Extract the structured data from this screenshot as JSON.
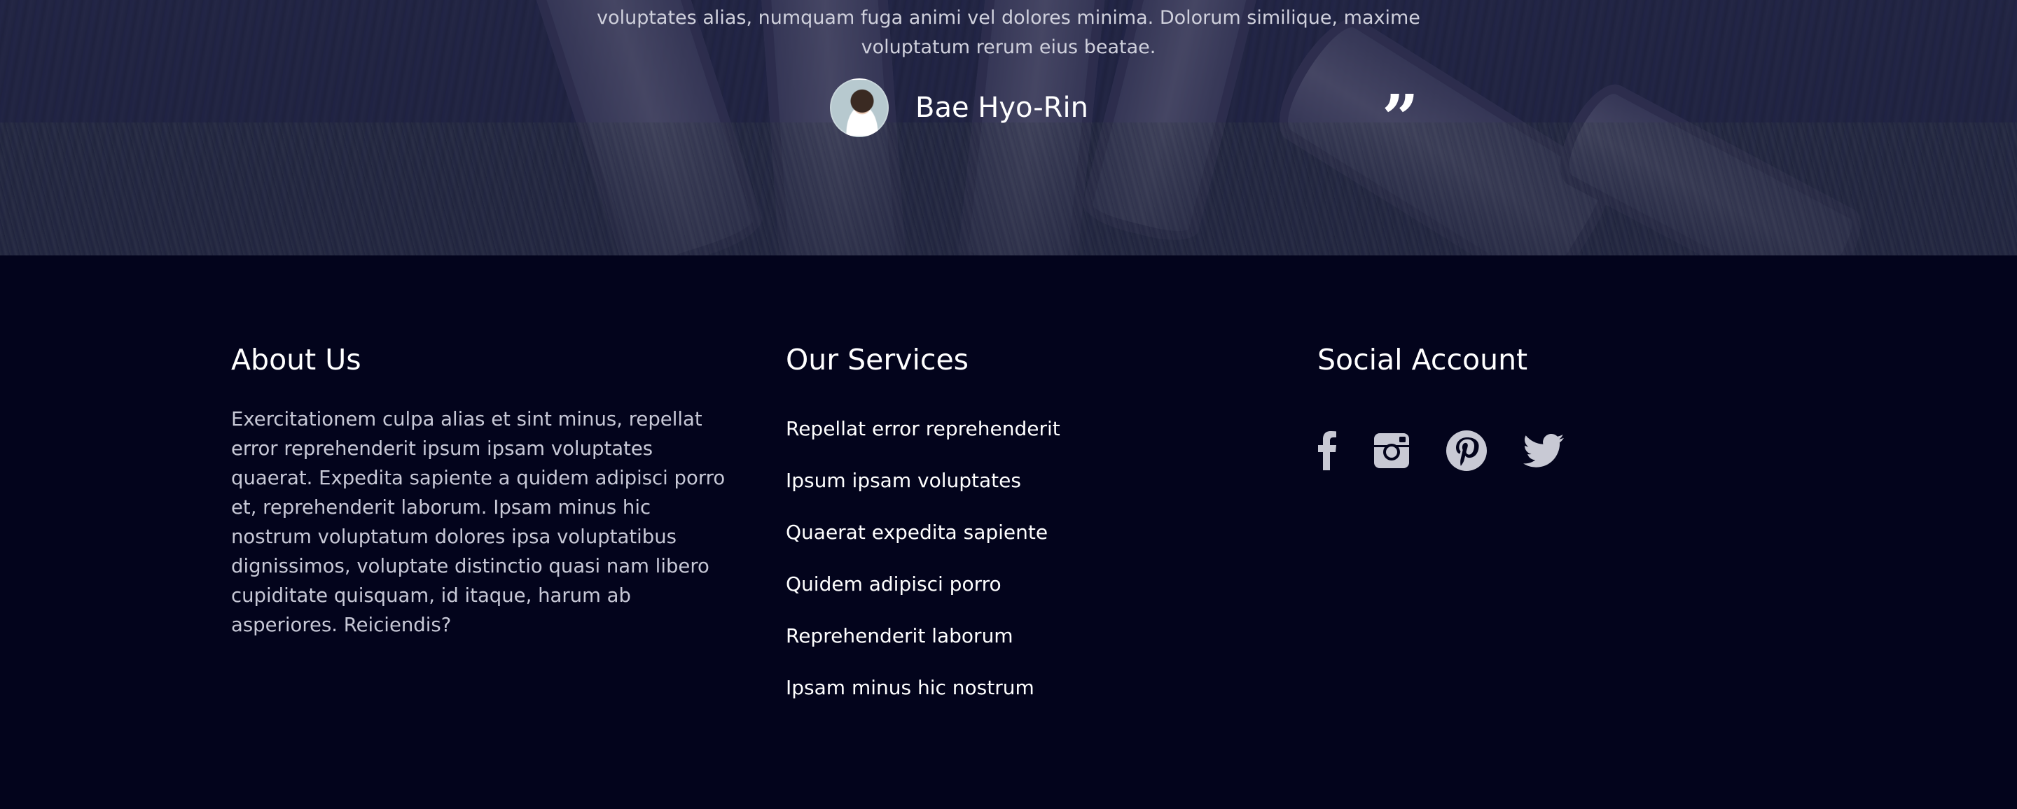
{
  "testimonial": {
    "quote_tail": "voluptates alias, numquam fuga animi vel dolores minima. Dolorum similique, maxime voluptatum rerum eius beatae.",
    "author_name": "Bae Hyo-Rin",
    "quote_mark": "“"
  },
  "footer": {
    "about": {
      "heading": "About Us",
      "text": "Exercitationem culpa alias et sint minus, repellat error reprehenderit ipsum ipsam voluptates quaerat. Expedita sapiente a quidem adipisci porro et, reprehenderit laborum. Ipsam minus hic nostrum voluptatum dolores ipsa voluptatibus dignissimos, voluptate distinctio quasi nam libero cupiditate quisquam, id itaque, harum ab asperiores. Reiciendis?"
    },
    "services": {
      "heading": "Our Services",
      "items": [
        "Repellat error reprehenderit",
        "Ipsum ipsam voluptates",
        "Quaerat expedita sapiente",
        "Quidem adipisci porro",
        "Reprehenderit laborum",
        "Ipsam minus hic nostrum"
      ]
    },
    "social": {
      "heading": "Social Account",
      "icons": [
        "facebook-icon",
        "instagram-icon",
        "pinterest-icon",
        "twitter-icon"
      ]
    }
  },
  "colors": {
    "footer_bg": "#03041c",
    "heading": "#ffffff",
    "body_text": "#c7c8d6",
    "icon": "#c8c9d4"
  }
}
